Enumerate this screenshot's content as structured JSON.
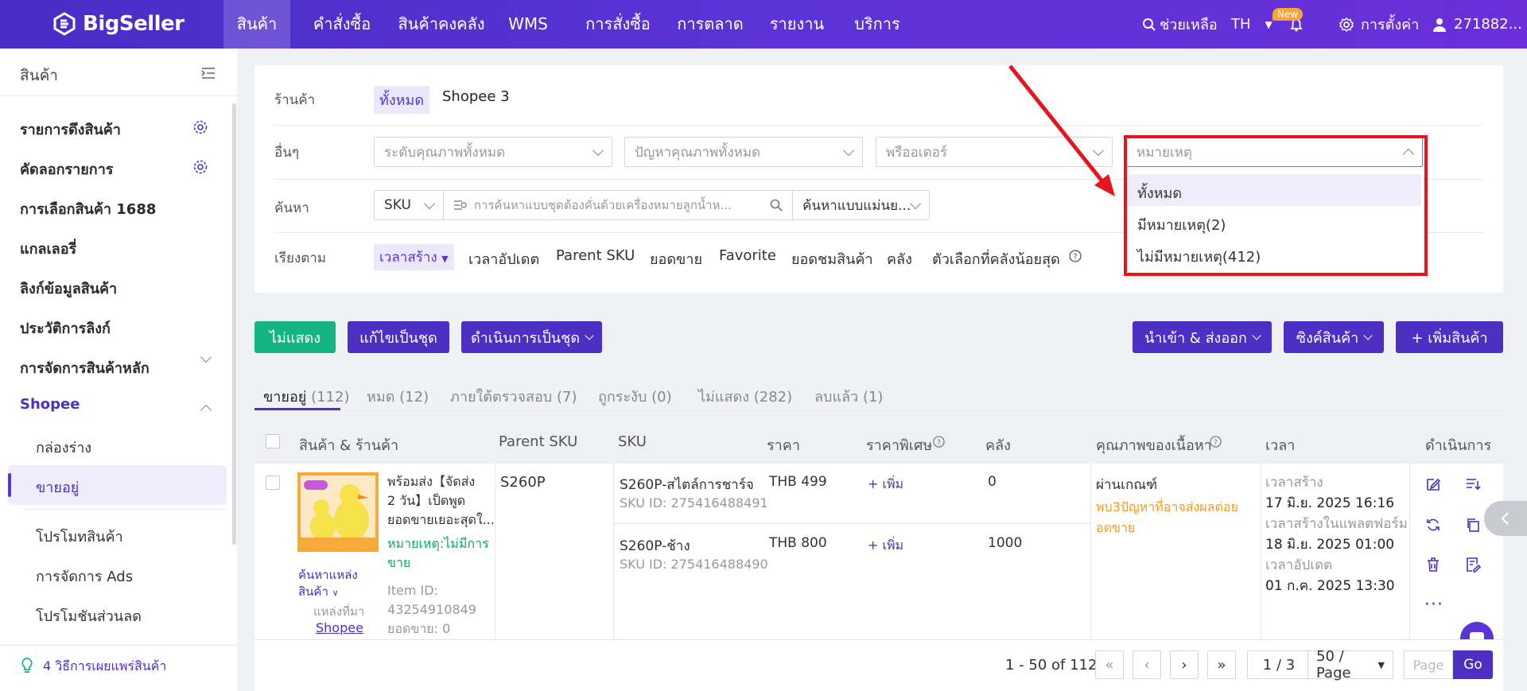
{
  "header": {
    "logo": "BigSeller",
    "nav": [
      "สินค้า",
      "คำสั่งซื้อ",
      "สินค้าคงคลัง",
      "WMS",
      "การสั่งซื้อ",
      "การตลาด",
      "รายงาน",
      "บริการ"
    ],
    "help": "ช่วยเหลือ",
    "lang": "TH",
    "badge_new": "New",
    "settings": "การตั้งค่า",
    "user": "271882..."
  },
  "sidebar": {
    "title": "สินค้า",
    "items": [
      "รายการดึงสินค้า",
      "คัดลอกรายการ",
      "การเลือกสินค้า 1688",
      "แกลเลอรี่",
      "ลิงก์ข้อมูลสินค้า",
      "ประวัติการลิงก์",
      "การจัดการสินค้าหลัก"
    ],
    "section": "Shopee",
    "subitems": [
      "กล่องร่าง",
      "ขายอยู่",
      "โปรโมทสินค้า",
      "การจัดการ Ads",
      "โปรโมชันส่วนลด"
    ],
    "bottom": "4 วิธีการเผยแพร่สินค้า"
  },
  "filters": {
    "store_label": "ร้านค้า",
    "store_all": "ทั้งหมด",
    "store_name": "Shopee 3",
    "other_label": "อื่นๆ",
    "quality_placeholder": "ระดับคุณภาพทั้งหมด",
    "issue_placeholder": "ปัญหาคุณภาพทั้งหมด",
    "preorder_placeholder": "พรีออเดอร์",
    "note_placeholder": "หมายเหตุ",
    "search_label": "ค้นหา",
    "search_type": "SKU",
    "search_placeholder": "การค้นหาแบบชุดต้องคั่นด้วยเครื่องหมายลูกน้ำห...",
    "search_mode": "ค้นหาแบบแม่นย...",
    "sort_label": "เรียงตาม",
    "sort_options": [
      "เวลาสร้าง",
      "เวลาอัปเดต",
      "Parent SKU",
      "ยอดขาย",
      "Favorite",
      "ยอดชมสินค้า",
      "คลัง",
      "ตัวเลือกที่คลังน้อยสุด"
    ]
  },
  "dropdown": {
    "options": [
      "ทั้งหมด",
      "มีหมายเหตุ(2)",
      "ไม่มีหมายเหตุ(412)"
    ]
  },
  "actions": {
    "hide": "ไม่แสดง",
    "bulk_edit": "แก้ไขเป็นชุด",
    "bulk_action": "ดำเนินการเป็นชุด",
    "import_export": "นำเข้า & ส่งออก",
    "sync": "ซิงค์สินค้า",
    "add": "+ เพิ่มสินค้า"
  },
  "tabs": [
    {
      "label": "ขายอยู่",
      "count": "(112)"
    },
    {
      "label": "หมด",
      "count": "(12)"
    },
    {
      "label": "ภายใต้ตรวจสอบ",
      "count": "(7)"
    },
    {
      "label": "ถูกระงับ",
      "count": "(0)"
    },
    {
      "label": "ไม่แสดง",
      "count": "(282)"
    },
    {
      "label": "ลบแล้ว",
      "count": "(1)"
    }
  ],
  "table": {
    "headers": [
      "สินค้า & ร้านค้า",
      "Parent SKU",
      "SKU",
      "ราคา",
      "ราคาพิเศษ",
      "คลัง",
      "คุณภาพของเนื้อหา",
      "เวลา",
      "ดำเนินการ"
    ],
    "product": {
      "title_lines": [
        "พร้อมส่ง【จัดส่ง",
        "2 วัน】เป็ดพูด",
        "ยอดขายเยอะสุดใ..."
      ],
      "note_lines": [
        "หมายเหตุ:ไม่มีการ",
        "ขาย"
      ],
      "item_id_label": "Item ID:",
      "item_id": "43254910849",
      "sales": "ยอดขาย: 0",
      "find_source_lines": [
        "ค้นหาแหล่ง",
        "สินค้า"
      ],
      "source_label": "แหล่งที่มา",
      "source": "Shopee"
    },
    "parent_sku": "S260P",
    "variants": [
      {
        "sku": "S260P-สไตล์การชาร์จ",
        "sku_id": "SKU ID: 275416488491",
        "price": "THB 499",
        "special": "+ เพิ่ม",
        "stock": "0"
      },
      {
        "sku": "S260P-ช้าง",
        "sku_id": "SKU ID: 275416488490",
        "price": "THB 800",
        "special": "+ เพิ่ม",
        "stock": "1000"
      }
    ],
    "quality": "ผ่านเกณฑ์",
    "quality_warn_lines": [
      "พบ3ปัญหาที่อาจส่งผลต่อย",
      "อดขาย"
    ],
    "time": {
      "created_label": "เวลาสร้าง",
      "created": "17 มิ.ย. 2025 16:16",
      "platform_label": "เวลาสร้างในแพลตฟอร์ม",
      "platform": "18 มิ.ย. 2025 01:00",
      "updated_label": "เวลาอัปเดต",
      "updated": "01 ก.ค. 2025 13:30"
    }
  },
  "pagination": {
    "summary": "1 - 50 of 112",
    "page": "1 / 3",
    "per_page": "50 / Page",
    "jump_placeholder": "Page",
    "go": "Go"
  },
  "colors": {
    "brand": "#4d2fc4",
    "green": "#15b583",
    "highlight": "#e8141c",
    "warn": "#f59a23"
  }
}
